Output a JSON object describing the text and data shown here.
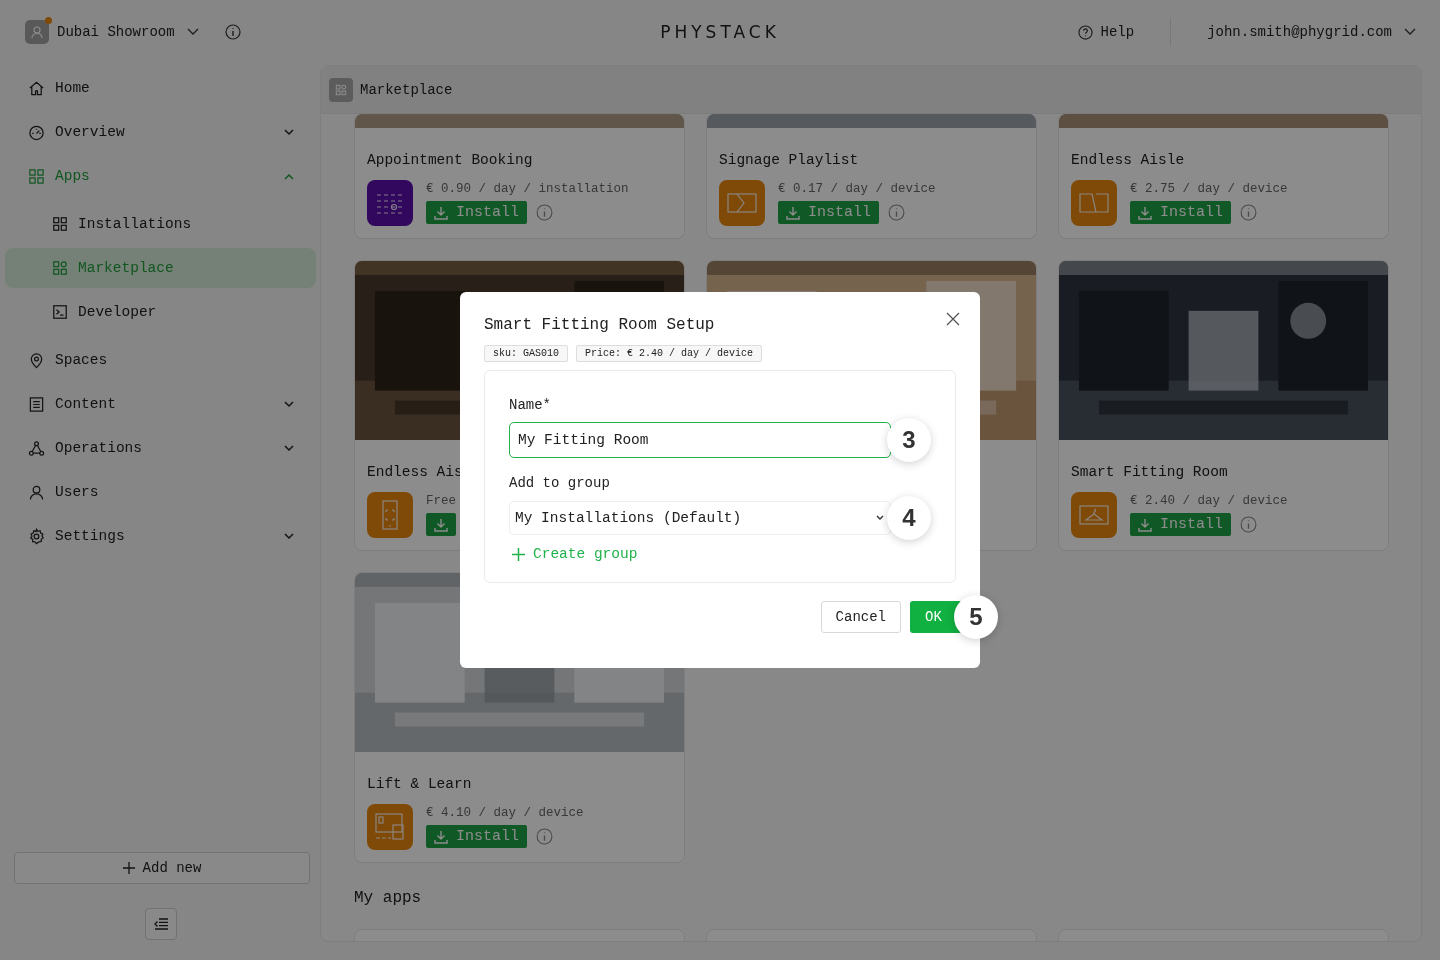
{
  "topbar": {
    "location": "Dubai Showroom",
    "logo": "PHYSTACK",
    "help": "Help",
    "account": "john.smith@phygrid.com"
  },
  "sidebar": {
    "items": [
      {
        "label": "Home",
        "selected": false
      },
      {
        "label": "Overview",
        "selected": false,
        "expanded": false
      },
      {
        "label": "Apps",
        "selected": false,
        "expanded": true,
        "children": [
          {
            "label": "Installations",
            "selected": false
          },
          {
            "label": "Marketplace",
            "selected": true
          },
          {
            "label": "Developer",
            "selected": false
          }
        ]
      },
      {
        "label": "Spaces",
        "selected": false
      },
      {
        "label": "Content",
        "selected": false,
        "expanded": false
      },
      {
        "label": "Operations",
        "selected": false,
        "expanded": false
      },
      {
        "label": "Users",
        "selected": false
      },
      {
        "label": "Settings",
        "selected": false,
        "expanded": false
      }
    ],
    "add_button": "Add new"
  },
  "panel": {
    "title": "Marketplace",
    "apps": [
      {
        "name": "Appointment Booking",
        "price": "€ 0.90 / day / installation",
        "install": "Install",
        "color": "#32085f"
      },
      {
        "name": "Signage Playlist",
        "price": "€ 0.17 / day / device",
        "install": "Install",
        "color": "#7f4907"
      },
      {
        "name": "Endless Aisle",
        "price": "€ 2.75 / day / device",
        "install": "Install",
        "color": "#7f4907"
      },
      {
        "name": "Endless Ais",
        "price": "Free",
        "color": "#7f4907"
      },
      {
        "kind": "picture"
      },
      {
        "name": "Smart Fitting Room",
        "price": "€ 2.40 / day / device",
        "install": "Install",
        "color": "#7f4907"
      },
      {
        "name": "Lift & Learn",
        "price": "€ 4.10 / day / device",
        "install": "Install",
        "color": "#7f4907"
      }
    ],
    "section_title": "My apps"
  },
  "dialog": {
    "title": "Smart Fitting Room Setup",
    "tags": [
      "sku: GAS010",
      "Price: € 2.40 / day / device"
    ],
    "name_label": "Name*",
    "name_value": "My Fitting Room",
    "group_label": "Add to group",
    "group_value": "My Installations (Default)",
    "create_group": "Create group",
    "cancel": "Cancel",
    "ok": "OK"
  },
  "steps": [
    "3",
    "4",
    "5"
  ]
}
